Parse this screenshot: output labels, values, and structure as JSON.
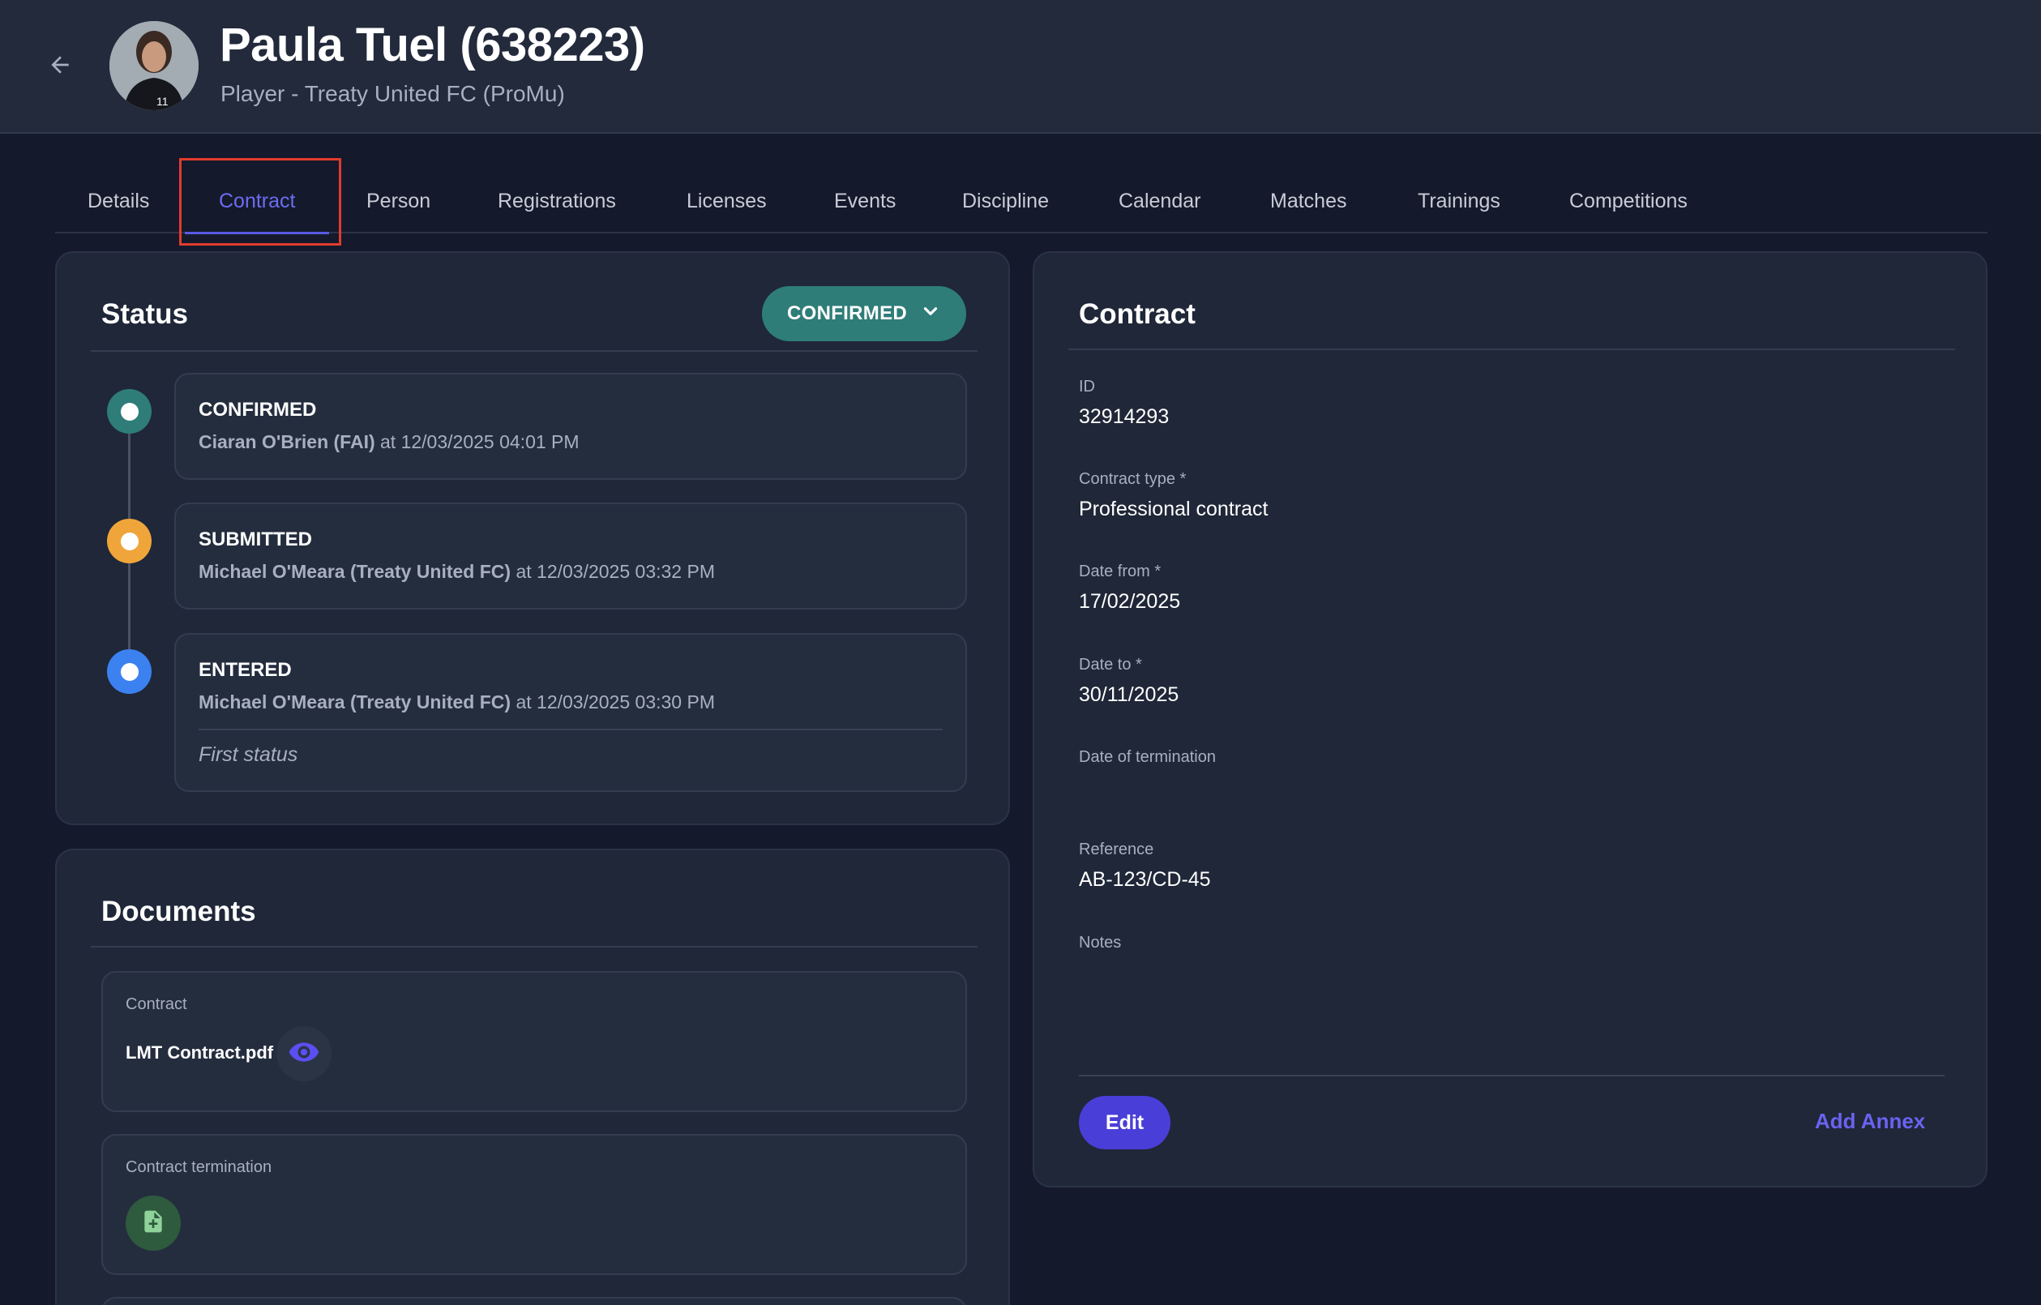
{
  "header": {
    "title": "Paula Tuel (638223)",
    "subtitle": "Player - Treaty United FC (ProMu)",
    "back_icon": "arrow-left-icon",
    "avatar_icon": "player-avatar"
  },
  "tabs": [
    {
      "label": "Details"
    },
    {
      "label": "Contract",
      "active": true
    },
    {
      "label": "Person"
    },
    {
      "label": "Registrations"
    },
    {
      "label": "Licenses"
    },
    {
      "label": "Events"
    },
    {
      "label": "Discipline"
    },
    {
      "label": "Calendar"
    },
    {
      "label": "Matches"
    },
    {
      "label": "Trainings"
    },
    {
      "label": "Competitions"
    }
  ],
  "status_card": {
    "title": "Status",
    "status_button": "CONFIRMED",
    "events": [
      {
        "status": "CONFIRMED",
        "who": "Ciaran O'Brien (FAI)",
        "when": " at 12/03/2025 04:01 PM",
        "color": "#2e7d78"
      },
      {
        "status": "SUBMITTED",
        "who": "Michael O'Meara (Treaty United FC)",
        "when": " at 12/03/2025 03:32 PM",
        "color": "#f0a53a"
      },
      {
        "status": "ENTERED",
        "who": "Michael O'Meara (Treaty United FC)",
        "when": " at 12/03/2025 03:30 PM",
        "note": "First status",
        "color": "#3b82f0"
      }
    ]
  },
  "documents_card": {
    "title": "Documents",
    "items": [
      {
        "label": "Contract",
        "file": "LMT Contract.pdf"
      },
      {
        "label": "Contract termination"
      }
    ]
  },
  "contract_card": {
    "title": "Contract",
    "fields": [
      {
        "label": "ID",
        "value": "32914293"
      },
      {
        "label": "Contract type *",
        "value": "Professional contract"
      },
      {
        "label": "Date from *",
        "value": "17/02/2025"
      },
      {
        "label": "Date to *",
        "value": "30/11/2025"
      },
      {
        "label": "Date of termination",
        "value": ""
      },
      {
        "label": "Reference",
        "value": "AB-123/CD-45"
      },
      {
        "label": "Notes",
        "value": ""
      }
    ],
    "edit_label": "Edit",
    "annex_label": "Add Annex"
  },
  "colors": {
    "accent": "#5a5ae6",
    "confirmed": "#2e7d78",
    "edit_button": "#4a3ed8",
    "highlight": "#e23b2e"
  }
}
